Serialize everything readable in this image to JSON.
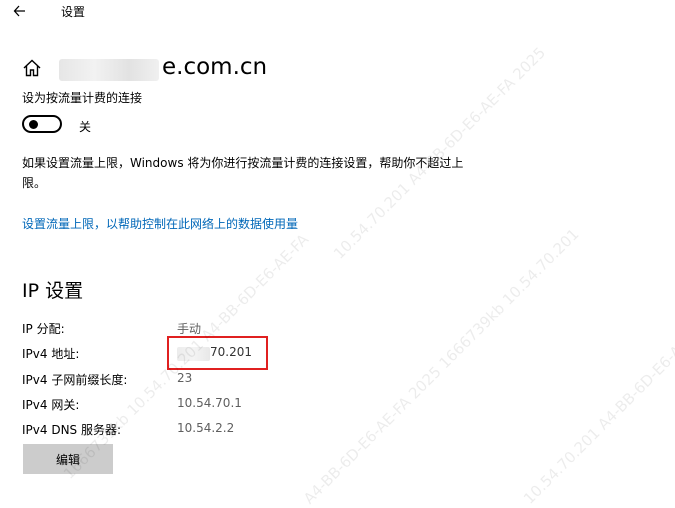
{
  "window": {
    "title": "设置"
  },
  "network": {
    "name_visible": "e.com.cn"
  },
  "metered": {
    "label": "设为按流量计费的连接",
    "state": "关",
    "description": "如果设置流量上限，Windows 将为你进行按流量计费的连接设置，帮助你不超过上限。",
    "link": "设置流量上限，以帮助控制在此网络上的数据使用量"
  },
  "ip": {
    "heading": "IP 设置",
    "rows": [
      {
        "label": "IP 分配:",
        "value": "手动"
      },
      {
        "label": "IPv4 地址:",
        "value": "70.201"
      },
      {
        "label": "IPv4 子网前缀长度:",
        "value": "23"
      },
      {
        "label": "IPv4 网关:",
        "value": "10.54.70.1"
      },
      {
        "label": "IPv4 DNS 服务器:",
        "value": "10.54.2.2"
      }
    ],
    "edit_label": "编辑"
  },
  "watermark": {
    "line1": "10.54.70.201 A4-BB-6D-E6-AE-FA 2025",
    "line2": "1666739kb 10.54.70.201 A4-BB-6D-E6-AE-FA",
    "line3": "A4-BB-6D-E6-AE-FA 2025 1666739kb 10.54.70.201",
    "line4": "10.54.70.201 A4-BB-6D-E6-AE-FA"
  }
}
